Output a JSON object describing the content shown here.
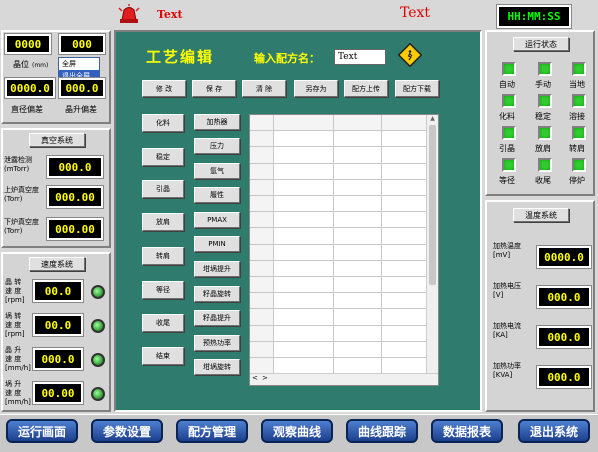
{
  "header": {
    "title_left": "Text",
    "title_center": "Text",
    "clock": "HH:MM:SS"
  },
  "left": {
    "top_val1": "0000",
    "top_val2": "000",
    "crystal_label": "晶位",
    "crystal_unit": "(mm)",
    "popup_items": [
      "全屏",
      "退出全屏"
    ],
    "diam_val": "0000.0",
    "lift_val": "000.0",
    "diam_label": "直径偏差",
    "lift_label": "晶升偏差",
    "vacuum_title": "真空系统",
    "leak_label": "泄露检测",
    "leak_unit": "(mTorr)",
    "leak_val": "000.0",
    "upper_label": "上炉真空度",
    "upper_unit": "(Torr)",
    "upper_val": "000.00",
    "lower_label": "下炉真空度",
    "lower_unit": "(Torr)",
    "lower_val": "000.00",
    "speed_title": "速度系统",
    "speed_rows": [
      {
        "l1": "晶 转",
        "l2": "速 度",
        "l3": "[rpm]",
        "val": "00.0"
      },
      {
        "l1": "埚 转",
        "l2": "速 度",
        "l3": "[rpm]",
        "val": "00.0"
      },
      {
        "l1": "晶 升",
        "l2": "速 度",
        "l3": "[mm/h]",
        "val": "000.0"
      },
      {
        "l1": "埚 升",
        "l2": "速 度",
        "l3": "[mm/h]",
        "val": "00.00"
      }
    ]
  },
  "center": {
    "title": "工艺编辑",
    "recipe_label": "输入配方名：",
    "recipe_value": "Text",
    "toolbar": [
      "修 改",
      "保 存",
      "清 除",
      "另存为",
      "配方上传",
      "配方下载"
    ],
    "col1": [
      "化料",
      "稳定",
      "引晶",
      "放肩",
      "转肩",
      "等径",
      "收尾",
      "结束"
    ],
    "col2": [
      "加热器",
      "压力",
      "氩气",
      "履性",
      "PMAX",
      "PMIN",
      "坩埚提升",
      "籽晶旋转",
      "籽晶提升",
      "预热功率",
      "坩埚旋转"
    ],
    "scroll_left": "<",
    "scroll_right": ">"
  },
  "right": {
    "status_title": "运行状态",
    "status_items": [
      "自动",
      "手动",
      "当地",
      "化料",
      "稳定",
      "溶接",
      "引晶",
      "放肩",
      "转肩",
      "等径",
      "收尾",
      "停炉"
    ],
    "temp_title": "温度系统",
    "temps": [
      {
        "l1": "加热温度",
        "l2": "[mV]",
        "val": "0000.0"
      },
      {
        "l1": "加热电压",
        "l2": "[V]",
        "val": "000.0"
      },
      {
        "l1": "加热电流",
        "l2": "[KA]",
        "val": "000.0"
      },
      {
        "l1": "加热功率",
        "l2": "[KVA]",
        "val": "000.0"
      }
    ]
  },
  "nav": [
    "运行画面",
    "参数设置",
    "配方管理",
    "观察曲线",
    "曲线跟踪",
    "数据报表",
    "退出系统"
  ]
}
